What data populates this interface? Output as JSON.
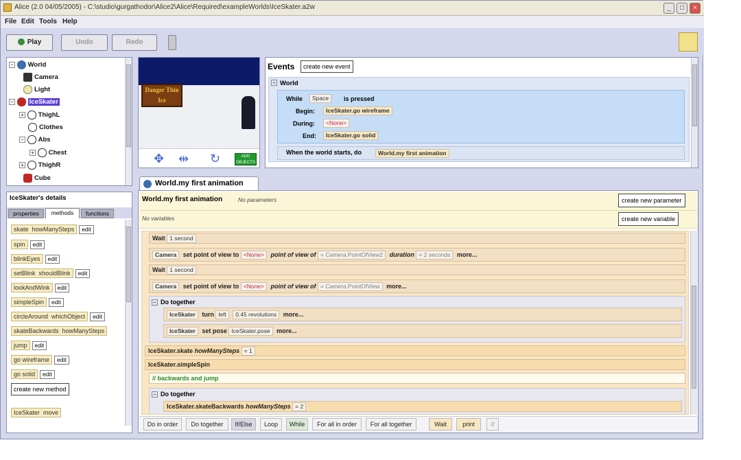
{
  "window": {
    "title": "Alice (2.0 04/05/2005) - C:\\studio\\gurgathodor\\Alice2\\Alice\\Required\\exampleWorlds\\IceSkater.a2w"
  },
  "menu": [
    "File",
    "Edit",
    "Tools",
    "Help"
  ],
  "toolbar": {
    "play": "Play",
    "undo": "Undo",
    "redo": "Redo"
  },
  "object_tree": [
    {
      "label": "World",
      "depth": 0,
      "expander": "minus"
    },
    {
      "label": "Camera",
      "depth": 1
    },
    {
      "label": "Light",
      "depth": 1
    },
    {
      "label": "IceSkater",
      "depth": 1,
      "expander": "minus",
      "selected": true
    },
    {
      "label": "ThighL",
      "depth": 2,
      "expander": "plus"
    },
    {
      "label": "Clothes",
      "depth": 2
    },
    {
      "label": "Abs",
      "depth": 2,
      "expander": "minus"
    },
    {
      "label": "Chest",
      "depth": 3,
      "expander": "plus"
    },
    {
      "label": "ThighR",
      "depth": 2,
      "expander": "plus"
    },
    {
      "label": "Cube",
      "depth": 1
    }
  ],
  "scene": {
    "sign_text": "Danger Thin Ice",
    "add_objects": "ADD OBJECTS"
  },
  "details": {
    "title": "IceSkater's details",
    "tabs": [
      "properties",
      "methods",
      "functions"
    ],
    "methods": [
      {
        "name": "skate",
        "param": "howManySteps",
        "edit": "edit"
      },
      {
        "name": "spin",
        "edit": "edit"
      },
      {
        "name": "blinkEyes",
        "edit": "edit"
      },
      {
        "name": "setBlink",
        "param": "shouldBlink",
        "edit": "edit"
      },
      {
        "name": "lookAndWink",
        "edit": "edit"
      },
      {
        "name": "simpleSpin",
        "edit": "edit"
      },
      {
        "name": "circleAround",
        "param": "whichObject",
        "edit": "edit"
      },
      {
        "name": "skateBackwards",
        "param": "howManySteps",
        "edit": "edit"
      },
      {
        "name": "jump",
        "edit": "edit"
      },
      {
        "name": "go wireframe",
        "edit": "edit"
      },
      {
        "name": "go solid",
        "edit": "edit"
      }
    ],
    "create_method": "create new method",
    "bottom_method": {
      "obj": "IceSkater",
      "name": "move"
    }
  },
  "events": {
    "title": "Events",
    "create_button": "create new event",
    "group": "World",
    "while": {
      "label": "While",
      "key": "Space",
      "is_pressed": "is pressed"
    },
    "begin": {
      "label": "Begin:",
      "value": "IceSkater.go wireframe"
    },
    "during": {
      "label": "During:",
      "value": "<None>"
    },
    "end": {
      "label": "End:",
      "value": "IceSkater.go solid"
    },
    "world_starts": {
      "label": "When the world starts, do",
      "value": "World.my first animation"
    }
  },
  "editor": {
    "tab": "World.my first animation",
    "method_title": "World.my first animation",
    "no_params": "No parameters",
    "create_param": "create new parameter",
    "no_vars": "No variables",
    "create_var": "create new variable",
    "statements": {
      "s1": {
        "a": "Wait",
        "b": "1 second"
      },
      "s2": {
        "obj": "Camera",
        "verb": "set point of view to",
        "target": "<None>",
        "pov_label": "point of view of",
        "pov_value": "= Camera.PointOfView2",
        "dur_label": "duration",
        "dur_value": "= 2 seconds",
        "more": "more..."
      },
      "s3": {
        "a": "Wait",
        "b": "1 second"
      },
      "s4": {
        "obj": "Camera",
        "verb": "set point of view to",
        "target": "<None>",
        "pov_label": "point of view of",
        "pov_value": "= Camera.PointOfView",
        "more": "more..."
      },
      "do_together_1": "Do together",
      "s5": {
        "obj": "IceSkater",
        "verb": "turn",
        "dir": "left",
        "amount": "0.45 revolutions",
        "more": "more..."
      },
      "s6": {
        "obj": "IceSkater",
        "verb": "set pose",
        "pose": "IceSkater.pose",
        "more": "more..."
      },
      "s7": {
        "call": "IceSkater.skate",
        "param": "howManySteps",
        "value": "= 1"
      },
      "s8": {
        "call": "IceSkater.simpleSpin"
      },
      "comment": "// backwards and jump",
      "do_together_2": "Do together",
      "s9": {
        "call": "IceSkater.skateBackwards",
        "param": "howManySteps",
        "value": "= 2"
      }
    }
  },
  "bottom_bar": [
    "Do in order",
    "Do together",
    "If/Else",
    "Loop",
    "While",
    "For all in order",
    "For all together",
    "Wait",
    "print",
    "//"
  ]
}
